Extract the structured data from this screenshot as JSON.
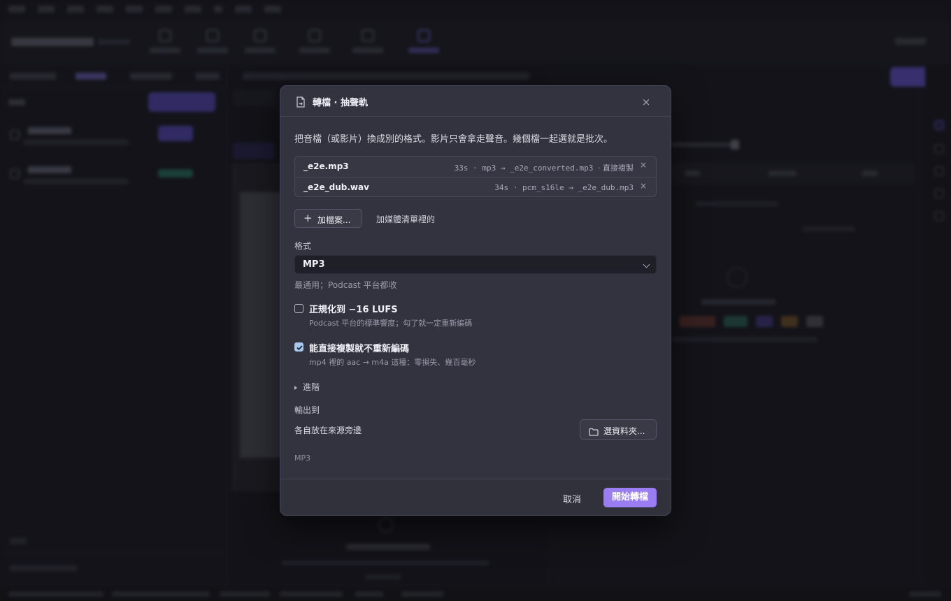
{
  "dialog": {
    "title": "轉檔 · 抽聲軌",
    "close_glyph": "×",
    "description": "把音檔（或影片）換成別的格式。影片只會拿走聲音。幾個檔一起選就是批次。",
    "files": [
      {
        "name": "_e2e.mp3",
        "duration": "33s",
        "sep": "·",
        "codec": "mp3",
        "arrow": "→",
        "output": "_e2e_converted.mp3",
        "note": "· 直接複製",
        "remove": "×"
      },
      {
        "name": "_e2e_dub.wav",
        "duration": "34s",
        "sep": "·",
        "codec": "pcm_s16le",
        "arrow": "→",
        "output": "_e2e_dub.mp3",
        "note": "",
        "remove": "×"
      }
    ],
    "add_files_label": "加檔案...",
    "add_from_media_label": "加媒體清單裡的",
    "format": {
      "label": "格式",
      "value": "MP3",
      "hint": "最通用；Podcast 平台都收"
    },
    "normalize": {
      "checked": false,
      "title": "正規化到 −16 LUFS",
      "hint": "Podcast 平台的標準響度；勾了就一定重新編碼"
    },
    "copy_direct": {
      "checked": true,
      "title": "能直接複製就不重新編碼",
      "hint": "mp4 裡的 aac → m4a 這種：零損失、幾百毫秒"
    },
    "advanced_label": "進階",
    "output": {
      "label": "輸出到",
      "value": "各自放在來源旁邊",
      "choose_folder_label": "選資料夾..."
    },
    "summary": "MP3",
    "cancel_label": "取消",
    "start_label": "開始轉檔"
  },
  "colors": {
    "accent": "#9b7df2",
    "dialog_bg": "#33333f",
    "checkbox_on": "#a8c8f0"
  },
  "icons": {
    "header": "file-convert-icon",
    "folder": "folder-icon",
    "add": "plus-icon",
    "close": "close-icon"
  }
}
